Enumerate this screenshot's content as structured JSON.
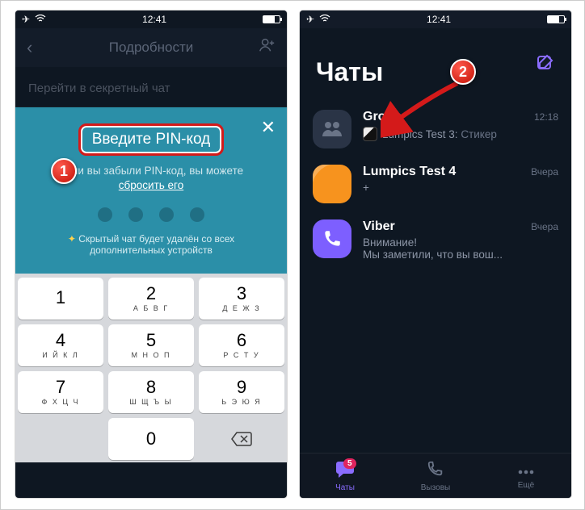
{
  "status": {
    "time": "12:41"
  },
  "left": {
    "header_title": "Подробности",
    "secret_link": "Перейти в секретный чат",
    "pin_title": "Введите PIN-код",
    "forgot_prefix": "Если вы забыли PIN-код, вы можете",
    "forgot_link": "сбросить его",
    "warning": "Скрытый чат будет удалён со всех дополнительных устройств",
    "keys": [
      {
        "n": "1",
        "l": ""
      },
      {
        "n": "2",
        "l": "А Б В Г"
      },
      {
        "n": "3",
        "l": "Д Е Ж З"
      },
      {
        "n": "4",
        "l": "И Й К Л"
      },
      {
        "n": "5",
        "l": "М Н О П"
      },
      {
        "n": "6",
        "l": "Р С Т У"
      },
      {
        "n": "7",
        "l": "Ф Х Ц Ч"
      },
      {
        "n": "8",
        "l": "Ш Щ Ъ Ы"
      },
      {
        "n": "9",
        "l": "Ь Э Ю Я"
      },
      {
        "n": "0",
        "l": ""
      }
    ]
  },
  "right": {
    "title": "Чаты",
    "chats": [
      {
        "name": "Group",
        "time": "12:18",
        "sender": "Lumpics Test 3:",
        "msg": "Cтикер"
      },
      {
        "name": "Lumpics Test 4",
        "time": "Вчера",
        "msg": "+"
      },
      {
        "name": "Viber",
        "time": "Вчера",
        "msg1": "Внимание!",
        "msg2": "Мы заметили, что вы вош..."
      }
    ],
    "tabs": {
      "chats": "Чаты",
      "calls": "Вызовы",
      "more": "Ещё",
      "badge": "5"
    }
  },
  "callouts": {
    "one": "1",
    "two": "2"
  }
}
